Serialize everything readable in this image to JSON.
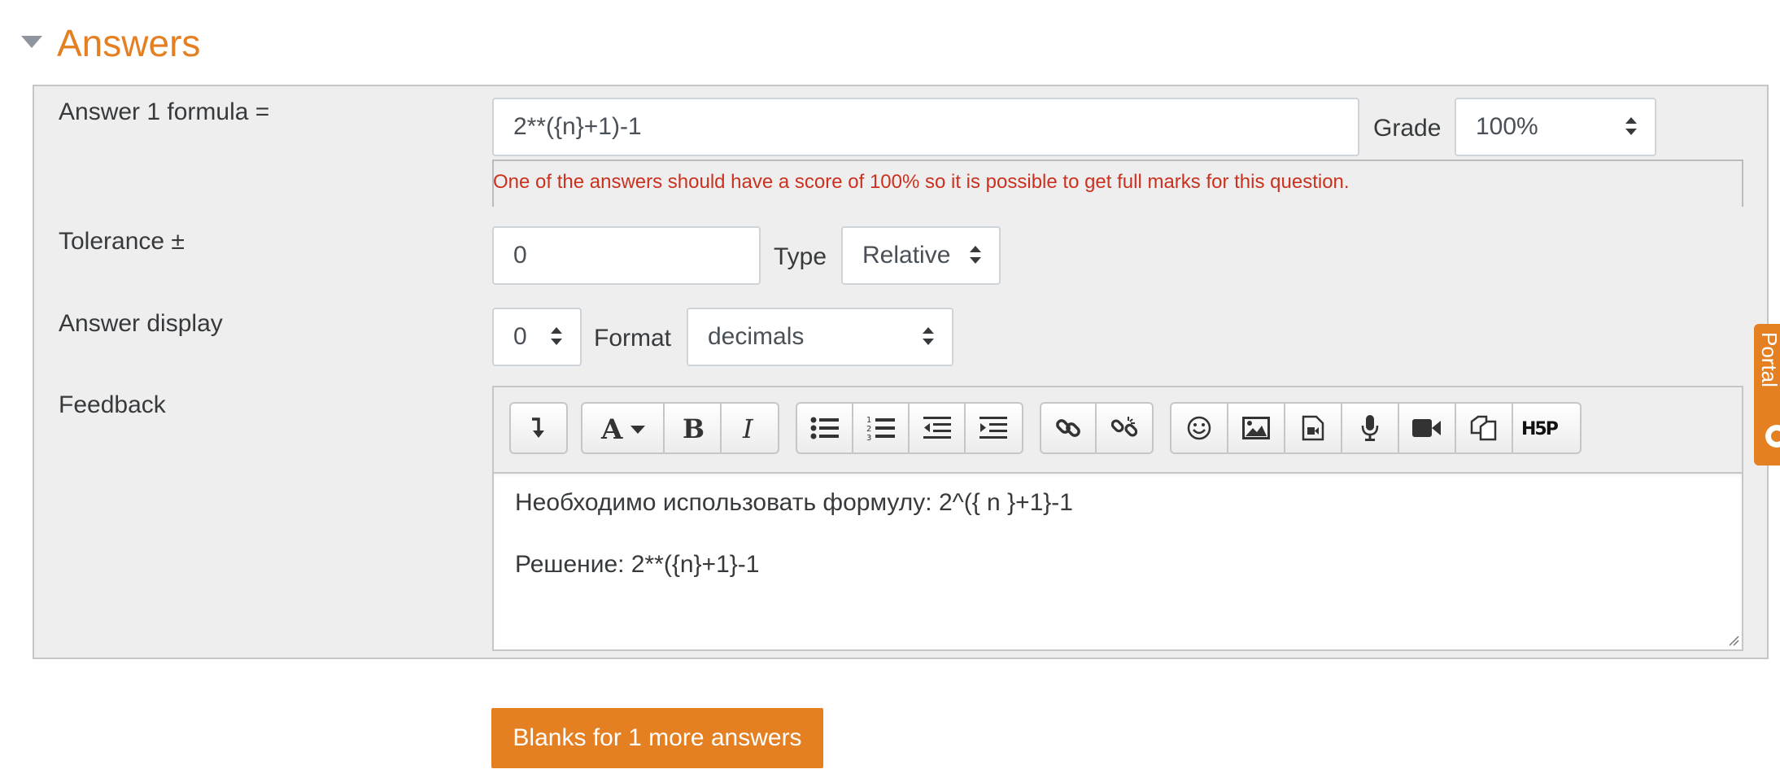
{
  "section": {
    "title": "Answers"
  },
  "answer1": {
    "formula_label": "Answer 1 formula =",
    "formula_value": "2**({n}+1)-1",
    "grade_label": "Grade",
    "grade_value": "100%",
    "grade_error": "One of the answers should have a score of 100% so it is possible to get full marks for this question."
  },
  "tolerance": {
    "label": "Tolerance ±",
    "value": "0",
    "type_label": "Type",
    "type_value": "Relative"
  },
  "answer_display": {
    "label": "Answer display",
    "value": "0",
    "format_label": "Format",
    "format_value": "decimals"
  },
  "feedback": {
    "label": "Feedback",
    "line1": "Необходимо использовать формулу: 2^({ n }+1}-1",
    "line2": "Решение: 2**({n}+1}-1",
    "toolbar": {
      "groups": [
        [
          "collapse-icon"
        ],
        [
          "font-style-icon",
          "bold-icon",
          "italic-icon"
        ],
        [
          "unordered-list-icon",
          "ordered-list-icon",
          "outdent-icon",
          "indent-icon"
        ],
        [
          "link-icon",
          "unlink-icon"
        ],
        [
          "emoji-icon",
          "image-icon",
          "media-icon",
          "record-audio-icon",
          "record-video-icon",
          "manage-files-icon",
          "h5p-icon"
        ]
      ],
      "h5p_text": "H5P"
    }
  },
  "more_answers_button": "Blanks for 1 more answers",
  "side_tab": {
    "label": "Portal"
  },
  "colors": {
    "accent": "#e47f22",
    "error": "#ca3120",
    "panel": "#eeeeee"
  }
}
